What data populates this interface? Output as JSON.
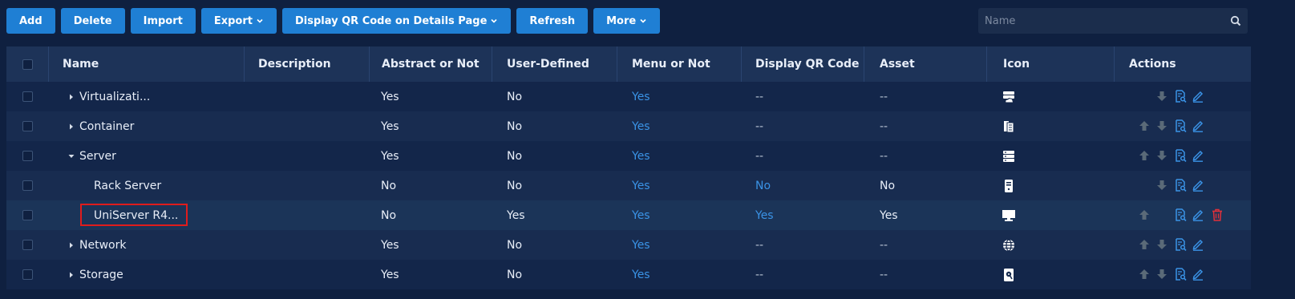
{
  "toolbar": {
    "add": "Add",
    "delete": "Delete",
    "import": "Import",
    "export": "Export",
    "qr": "Display QR Code on Details Page",
    "refresh": "Refresh",
    "more": "More"
  },
  "search": {
    "placeholder": "Name"
  },
  "columns": {
    "name": "Name",
    "description": "Description",
    "abstract": "Abstract or Not",
    "user_defined": "User-Defined",
    "menu": "Menu or Not",
    "qr": "Display QR Code on",
    "asset": "Asset",
    "icon": "Icon",
    "actions": "Actions"
  },
  "rows": [
    {
      "name": "Virtualizati...",
      "expand": "collapsed",
      "abstract": "Yes",
      "user_defined": "No",
      "menu": "Yes",
      "qr": "--",
      "asset": "--",
      "icon": "cloud-server-icon",
      "actions": [
        "down"
      ]
    },
    {
      "name": "Container",
      "expand": "collapsed",
      "abstract": "Yes",
      "user_defined": "No",
      "menu": "Yes",
      "qr": "--",
      "asset": "--",
      "icon": "container-icon",
      "actions": [
        "up",
        "down"
      ]
    },
    {
      "name": "Server",
      "expand": "expanded",
      "abstract": "Yes",
      "user_defined": "No",
      "menu": "Yes",
      "qr": "--",
      "asset": "--",
      "icon": "server-icon",
      "actions": [
        "up",
        "down"
      ]
    },
    {
      "name": "Rack Server",
      "expand": "none",
      "abstract": "No",
      "user_defined": "No",
      "menu": "Yes",
      "qr": "No",
      "asset": "No",
      "icon": "rack-server-icon",
      "actions": [
        "down"
      ]
    },
    {
      "name": "UniServer R4...",
      "expand": "none",
      "abstract": "No",
      "user_defined": "Yes",
      "menu": "Yes",
      "qr": "Yes",
      "asset": "Yes",
      "icon": "monitor-icon",
      "actions": [
        "up",
        "delete"
      ]
    },
    {
      "name": "Network",
      "expand": "collapsed",
      "abstract": "Yes",
      "user_defined": "No",
      "menu": "Yes",
      "qr": "--",
      "asset": "--",
      "icon": "globe-icon",
      "actions": [
        "up",
        "down"
      ]
    },
    {
      "name": "Storage",
      "expand": "collapsed",
      "abstract": "Yes",
      "user_defined": "No",
      "menu": "Yes",
      "qr": "--",
      "asset": "--",
      "icon": "storage-icon",
      "actions": [
        "up",
        "down"
      ]
    }
  ],
  "colors": {
    "accent": "#1f7fd4",
    "link": "#3a93e6",
    "delete": "#e0303a",
    "arrow": "#5a6a78",
    "highlight": "#e01c1c"
  }
}
